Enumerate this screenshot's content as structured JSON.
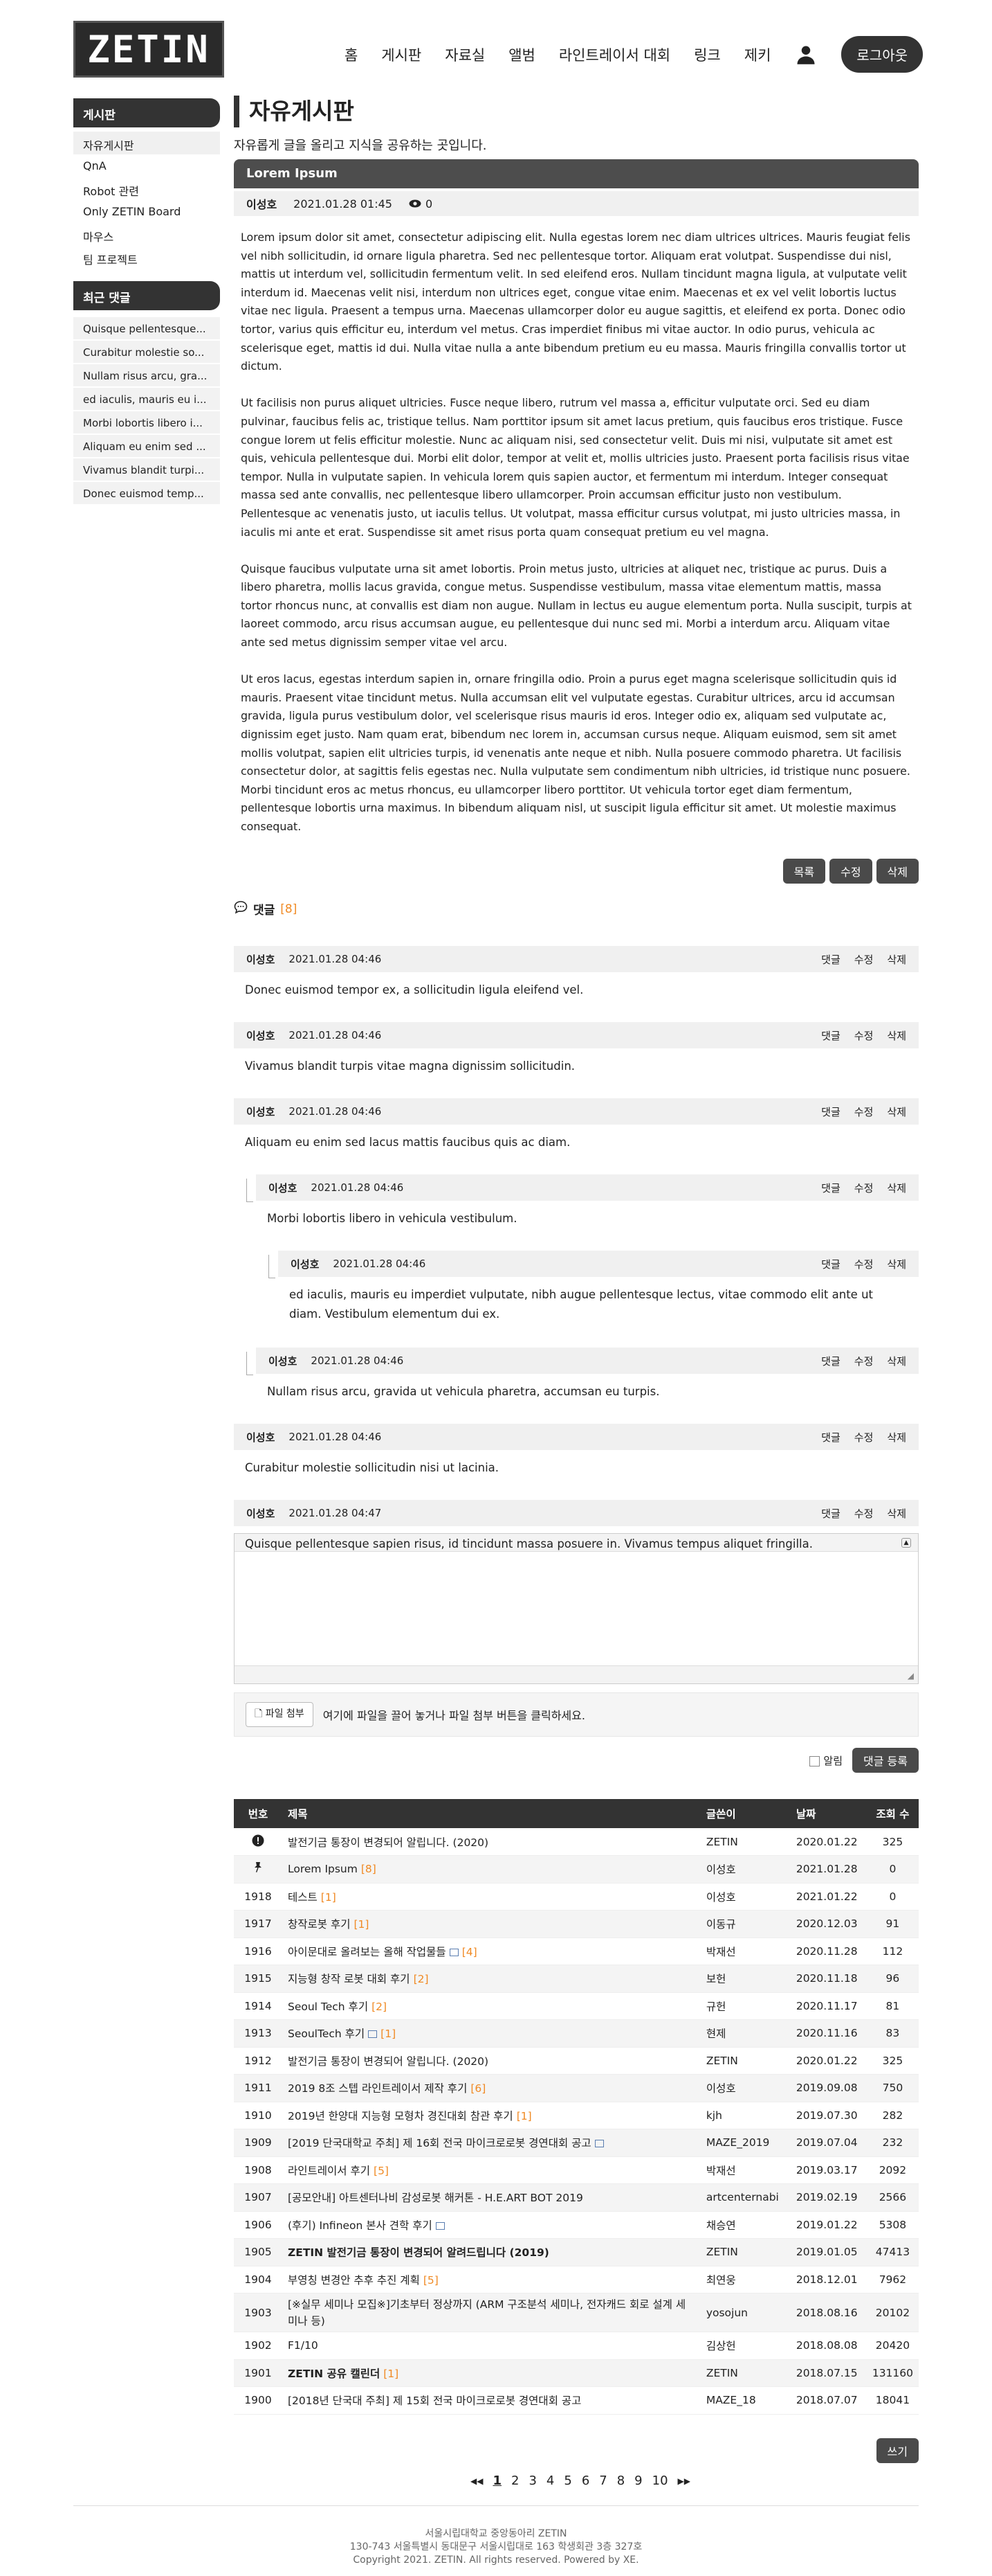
{
  "header": {
    "logo": "ZETIN",
    "nav": [
      "홈",
      "게시판",
      "자료실",
      "앨범",
      "라인트레이서 대회",
      "링크",
      "제키"
    ],
    "logout": "로그아웃"
  },
  "sidebar": {
    "board_title": "게시판",
    "board_items": [
      "자유게시판",
      "QnA",
      "Robot 관련",
      "Only ZETIN Board",
      "마우스",
      "팀 프로젝트"
    ],
    "recent_title": "최근 댓글",
    "recent_items": [
      "Quisque pellentesque...",
      "Curabitur molestie so...",
      "Nullam risus arcu, gra...",
      "ed iaculis, mauris eu i...",
      "Morbi lobortis libero i...",
      "Aliquam eu enim sed ...",
      "Vivamus blandit turpi...",
      "Donec euismod temp..."
    ]
  },
  "page": {
    "title": "자유게시판",
    "desc": "자유롭게 글을 올리고 지식을 공유하는 곳입니다."
  },
  "post": {
    "title": "Lorem Ipsum",
    "author": "이성호",
    "date": "2021.01.28 01:45",
    "views": "0",
    "paragraphs": [
      "Lorem ipsum dolor sit amet, consectetur adipiscing elit. Nulla egestas lorem nec diam ultrices ultrices. Mauris feugiat felis vel nibh sollicitudin, id ornare ligula pharetra. Sed nec pellentesque tortor. Aliquam erat volutpat. Suspendisse dui nisl, mattis ut interdum vel, sollicitudin fermentum velit. In sed eleifend eros. Nullam tincidunt magna ligula, at vulputate velit interdum id. Maecenas velit nisi, interdum non ultrices eget, congue vitae enim. Maecenas et ex vel velit lobortis luctus vitae nec ligula. Praesent a tempus urna. Maecenas ullamcorper dolor eu augue sagittis, et eleifend ex porta. Donec odio tortor, varius quis efficitur eu, interdum vel metus. Cras imperdiet finibus mi vitae auctor. In odio purus, vehicula ac scelerisque eget, mattis id dui. Nulla vitae nulla a ante bibendum pretium eu eu massa. Mauris fringilla convallis tortor ut dictum.",
      "Ut facilisis non purus aliquet ultricies. Fusce neque libero, rutrum vel massa a, efficitur vulputate orci. Sed eu diam pulvinar, faucibus felis ac, tristique tellus. Nam porttitor ipsum sit amet lacus pretium, quis faucibus eros tristique. Fusce congue lorem ut felis efficitur molestie. Nunc ac aliquam nisi, sed consectetur velit. Duis mi nisi, vulputate sit amet est quis, vehicula pellentesque dui. Morbi elit dolor, tempor at velit et, mollis ultricies justo. Praesent porta facilisis risus vitae tempor. Nulla in vulputate sapien. In vehicula lorem quis sapien auctor, et fermentum mi interdum. Integer consequat massa sed ante convallis, nec pellentesque libero ullamcorper. Proin accumsan efficitur justo non vestibulum. Pellentesque ac venenatis justo, ut iaculis tellus. Ut volutpat, massa efficitur cursus volutpat, mi justo ultricies massa, in iaculis mi ante et erat. Suspendisse sit amet risus porta quam consequat pretium eu vel magna.",
      "Quisque faucibus vulputate urna sit amet lobortis. Proin metus justo, ultricies at aliquet nec, tristique ac purus. Duis a libero pharetra, mollis lacus gravida, congue metus. Suspendisse vestibulum, massa vitae elementum mattis, massa tortor rhoncus nunc, at convallis est diam non augue. Nullam in lectus eu augue elementum porta. Nulla suscipit, turpis at laoreet commodo, arcu risus accumsan augue, eu pellentesque dui nunc sed mi. Morbi a interdum arcu. Aliquam vitae ante sed metus dignissim semper vitae vel arcu.",
      "Ut eros lacus, egestas interdum sapien in, ornare fringilla odio. Proin a purus eget magna scelerisque sollicitudin quis id mauris. Praesent vitae tincidunt metus. Nulla accumsan elit vel vulputate egestas. Curabitur ultrices, arcu id accumsan gravida, ligula purus vestibulum dolor, vel scelerisque risus mauris id eros. Integer odio ex, aliquam sed vulputate ac, dignissim eget justo. Nam quam erat, bibendum nec lorem in, accumsan cursus neque. Aliquam euismod, sem sit amet mollis volutpat, sapien elit ultricies turpis, id venenatis ante neque et nibh. Nulla posuere commodo pharetra. Ut facilisis consectetur dolor, at sagittis felis egestas nec. Nulla vulputate sem condimentum nibh ultricies, id tristique nunc posuere. Morbi tincidunt eros ac metus rhoncus, eu ullamcorper libero porttitor. Ut vehicula tortor eget diam fermentum, pellentesque lobortis urna maximus. In bibendum aliquam nisl, ut suscipit ligula efficitur sit amet. Ut molestie maximus consequat."
    ],
    "buttons": [
      "목록",
      "수정",
      "삭제"
    ]
  },
  "comments": {
    "label": "댓글",
    "count": "[8]",
    "actions": [
      "댓글",
      "수정",
      "삭제"
    ],
    "items": [
      {
        "author": "이성호",
        "date": "2021.01.28 04:46",
        "text": "Donec euismod tempor ex, a sollicitudin ligula eleifend vel."
      },
      {
        "author": "이성호",
        "date": "2021.01.28 04:46",
        "text": "Vivamus blandit turpis vitae magna dignissim sollicitudin."
      },
      {
        "author": "이성호",
        "date": "2021.01.28 04:46",
        "text": "Aliquam eu enim sed lacus mattis faucibus quis ac diam."
      },
      {
        "author": "이성호",
        "date": "2021.01.28 04:46",
        "text": "Morbi lobortis libero in vehicula vestibulum."
      },
      {
        "author": "이성호",
        "date": "2021.01.28 04:46",
        "text": "ed iaculis, mauris eu imperdiet vulputate, nibh augue pellentesque lectus, vitae commodo elit ante ut diam. Vestibulum elementum dui ex."
      },
      {
        "author": "이성호",
        "date": "2021.01.28 04:46",
        "text": "Nullam risus arcu, gravida ut vehicula pharetra, accumsan eu turpis."
      },
      {
        "author": "이성호",
        "date": "2021.01.28 04:46",
        "text": "Curabitur molestie sollicitudin nisi ut lacinia."
      },
      {
        "author": "이성호",
        "date": "2021.01.28 04:47",
        "text": "Quisque pellentesque sapien risus, id tincidunt massa posuere in. Vivamus tempus aliquet fringilla."
      }
    ],
    "upload_button": "파일 첨부",
    "upload_hint": "여기에 파일을 끌어 놓거나 파일 첨부 버튼을 클릭하세요.",
    "notify": "알림",
    "submit": "댓글 등록"
  },
  "board": {
    "columns": [
      "번호",
      "제목",
      "글쓴이",
      "날짜",
      "조회 수"
    ],
    "rows": [
      {
        "no": "",
        "icon": "notice",
        "title": "발전기금 통장이 변경되어 알립니다. (2020)",
        "c": "",
        "author": "ZETIN",
        "date": "2020.01.22",
        "views": "325"
      },
      {
        "no": "",
        "icon": "pin",
        "title": "Lorem Ipsum",
        "c": "[8]",
        "author": "이성호",
        "date": "2021.01.28",
        "views": "0"
      },
      {
        "no": "1918",
        "title": "테스트",
        "c": "[1]",
        "author": "이성호",
        "date": "2021.01.22",
        "views": "0"
      },
      {
        "no": "1917",
        "title": "창작로봇 후기",
        "c": "[1]",
        "author": "이동규",
        "date": "2020.12.03",
        "views": "91"
      },
      {
        "no": "1916",
        "title": "아이문대로 올려보는 올해 작업물들",
        "img": true,
        "c": "[4]",
        "author": "박재선",
        "date": "2020.11.28",
        "views": "112"
      },
      {
        "no": "1915",
        "title": "지능형 창작 로봇 대회 후기",
        "c": "[2]",
        "author": "보헌",
        "date": "2020.11.18",
        "views": "96"
      },
      {
        "no": "1914",
        "title": "Seoul Tech 후기",
        "c": "[2]",
        "author": "규헌",
        "date": "2020.11.17",
        "views": "81"
      },
      {
        "no": "1913",
        "title": "SeoulTech 후기",
        "img": true,
        "c": "[1]",
        "author": "현제",
        "date": "2020.11.16",
        "views": "83"
      },
      {
        "no": "1912",
        "title": "발전기금 통장이 변경되어 알립니다. (2020)",
        "c": "",
        "author": "ZETIN",
        "date": "2020.01.22",
        "views": "325"
      },
      {
        "no": "1911",
        "title": "2019 8조 스텝 라인트레이서 제작 후기",
        "c": "[6]",
        "author": "이성호",
        "date": "2019.09.08",
        "views": "750"
      },
      {
        "no": "1910",
        "title": "2019년 한양대 지능형 모형차 경진대회 참관 후기",
        "c": "[1]",
        "author": "kjh",
        "date": "2019.07.30",
        "views": "282"
      },
      {
        "no": "1909",
        "title": "[2019 단국대학교 주최] 제 16회 전국 마이크로로봇 경연대회 공고",
        "img": true,
        "c": "",
        "author": "MAZE_2019",
        "date": "2019.07.04",
        "views": "232"
      },
      {
        "no": "1908",
        "title": "라인트레이서 후기",
        "c": "[5]",
        "author": "박재선",
        "date": "2019.03.17",
        "views": "2092"
      },
      {
        "no": "1907",
        "title": "[공모안내] 아트센터나비 감성로봇 해커톤 - H.E.ART BOT 2019",
        "c": "",
        "author": "artcenternabi",
        "date": "2019.02.19",
        "views": "2566"
      },
      {
        "no": "1906",
        "title": "(후기) Infineon 본사 견학 후기",
        "img": true,
        "c": "",
        "author": "채승연",
        "date": "2019.01.22",
        "views": "5308"
      },
      {
        "no": "1905",
        "title": "ZETIN 발전기금 통장이 변경되어 알려드립니다 (2019)",
        "bold": true,
        "c": "",
        "author": "ZETIN",
        "date": "2019.01.05",
        "views": "47413"
      },
      {
        "no": "1904",
        "title": "부영칭 변경안 추후 추진 계획",
        "c": "[5]",
        "author": "최연웅",
        "date": "2018.12.01",
        "views": "7962"
      },
      {
        "no": "1903",
        "title": "[※실무 세미나 모집※]기초부터 정상까지 (ARM 구조분석 세미나, 전자캐드 회로 설계 세미나 등)",
        "c": "",
        "author": "yosojun",
        "date": "2018.08.16",
        "views": "20102",
        "tall": true
      },
      {
        "no": "1902",
        "title": "F1/10",
        "c": "",
        "author": "김상헌",
        "date": "2018.08.08",
        "views": "20420"
      },
      {
        "no": "1901",
        "title": "ZETIN 공유 캘린더",
        "bold": true,
        "c": "[1]",
        "author": "ZETIN",
        "date": "2018.07.15",
        "views": "131160"
      },
      {
        "no": "1900",
        "title": "[2018년 단국대 주최] 제 15회 전국 마이크로로봇 경연대회 공고",
        "c": "",
        "author": "MAZE_18",
        "date": "2018.07.07",
        "views": "18041"
      }
    ],
    "write": "쓰기",
    "pages": [
      "1",
      "2",
      "3",
      "4",
      "5",
      "6",
      "7",
      "8",
      "9",
      "10"
    ]
  },
  "footer": {
    "line1": "서울시립대학교 중앙동아리 ZETIN",
    "line2": "130-743 서울특별시 동대문구 서울시립대로 163 학생회관 3층 327호",
    "line3": "Copyright 2021. ZETIN. All rights reserved. Powered by XE."
  }
}
